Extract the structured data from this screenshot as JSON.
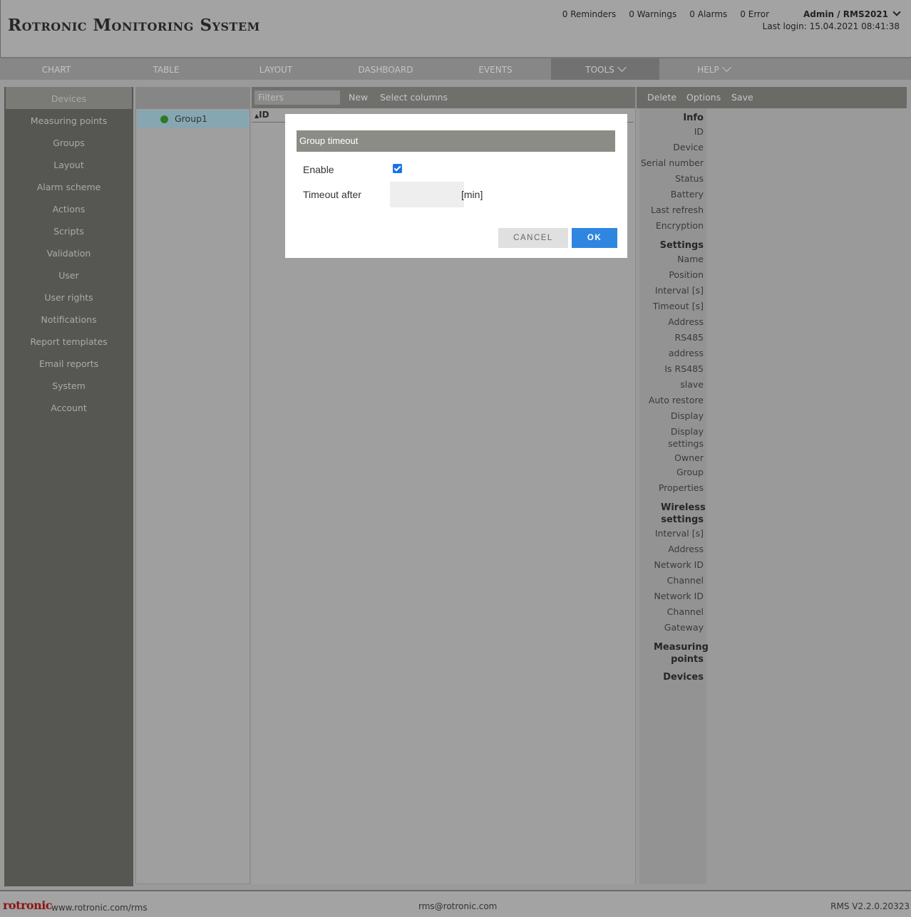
{
  "header": {
    "app_title": "Rotronic Monitoring System",
    "counters": [
      "0 Reminders",
      "0 Warnings",
      "0 Alarms",
      "0 Error"
    ],
    "user": "Admin / RMS2021",
    "last_login": "Last login: 15.04.2021 08:41:38"
  },
  "nav": {
    "tabs": [
      "CHART",
      "TABLE",
      "LAYOUT",
      "DASHBOARD",
      "EVENTS",
      "TOOLS",
      "HELP"
    ],
    "active": "TOOLS"
  },
  "sidebar": {
    "items": [
      "Devices",
      "Measuring points",
      "Groups",
      "Layout",
      "Alarm scheme",
      "Actions",
      "Scripts",
      "Validation",
      "User",
      "User rights",
      "Notifications",
      "Report templates",
      "Email reports",
      "System",
      "Account"
    ],
    "active": "Devices"
  },
  "groups": {
    "items": [
      "Group1"
    ],
    "status_color": "#2e7a22"
  },
  "table": {
    "filters_placeholder": "Filters",
    "new_label": "New",
    "select_columns_label": "Select columns",
    "col_id": "ID"
  },
  "details_toolbar": {
    "delete": "Delete",
    "options": "Options",
    "save": "Save"
  },
  "properties": {
    "info_title": "Info",
    "info": [
      "ID",
      "Device",
      "Serial number",
      "Status",
      "Battery",
      "Last refresh",
      "Encryption"
    ],
    "settings_title": "Settings",
    "settings": [
      "Name",
      "Position",
      "Interval [s]",
      "Timeout [s]",
      "Address",
      "RS485 address",
      "Is RS485 slave",
      "Auto restore",
      "Display",
      "Display settings",
      "Owner",
      "Group",
      "Properties"
    ],
    "wireless_title": "Wireless settings",
    "wireless": [
      "Interval [s]",
      "Address",
      "Network ID",
      "Channel",
      "Network ID",
      "Channel",
      "Gateway"
    ],
    "measuring_points_title": "Measuring points",
    "devices_title": "Devices"
  },
  "dialog": {
    "title": "Group timeout",
    "enable_label": "Enable",
    "enable_checked": true,
    "timeout_label": "Timeout after",
    "timeout_value": "",
    "unit": "[min]",
    "cancel": "CANCEL",
    "ok": "OK",
    "ok_color": "#2f86e0"
  },
  "footer": {
    "logo": "rotronic",
    "url": "www.rotronic.com/rms",
    "email": "rms@rotronic.com",
    "version": "RMS V2.2.0.20323"
  }
}
